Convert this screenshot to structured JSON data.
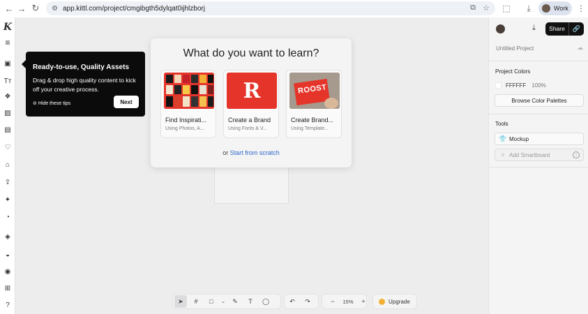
{
  "browser": {
    "url": "app.kittl.com/project/cmgibgth5dylqat0ijhlzborj",
    "profile_label": "Work"
  },
  "learn_modal": {
    "title": "What do you want to learn?",
    "cards": [
      {
        "title": "Find Inspirati...",
        "subtitle": "Using Photos, A..."
      },
      {
        "title": "Create a Brand",
        "subtitle": "Using Fonts & V..."
      },
      {
        "title": "Create Brand...",
        "subtitle": "Using Template..."
      }
    ],
    "or_text": "or",
    "scratch_link": "Start from scratch",
    "thumb_text": {
      "brand": "R",
      "roost": "ROOST"
    }
  },
  "tooltip": {
    "title": "Ready-to-use, Quality Assets",
    "body": "Drag & drop high quality content to kick off your creative process.",
    "hide_tips": "Hide these tips",
    "next": "Next"
  },
  "toolbar": {
    "zoom": "15%",
    "minus": "−",
    "plus": "+",
    "upgrade": "Upgrade"
  },
  "right_panel": {
    "share": "Share",
    "project_name": "Untitled Project",
    "project_colors_title": "Project Colors",
    "color_hex": "FFFFFF",
    "color_opacity": "100%",
    "browse_palettes": "Browse Color Palettes",
    "tools_title": "Tools",
    "mockup": "Mockup",
    "add_smartboard": "Add Smartboard"
  },
  "colors": {
    "accent_red": "#e5352b",
    "link_blue": "#2d67c8",
    "tooltip_bg": "#0b0b0c",
    "share_bg": "#111111"
  }
}
